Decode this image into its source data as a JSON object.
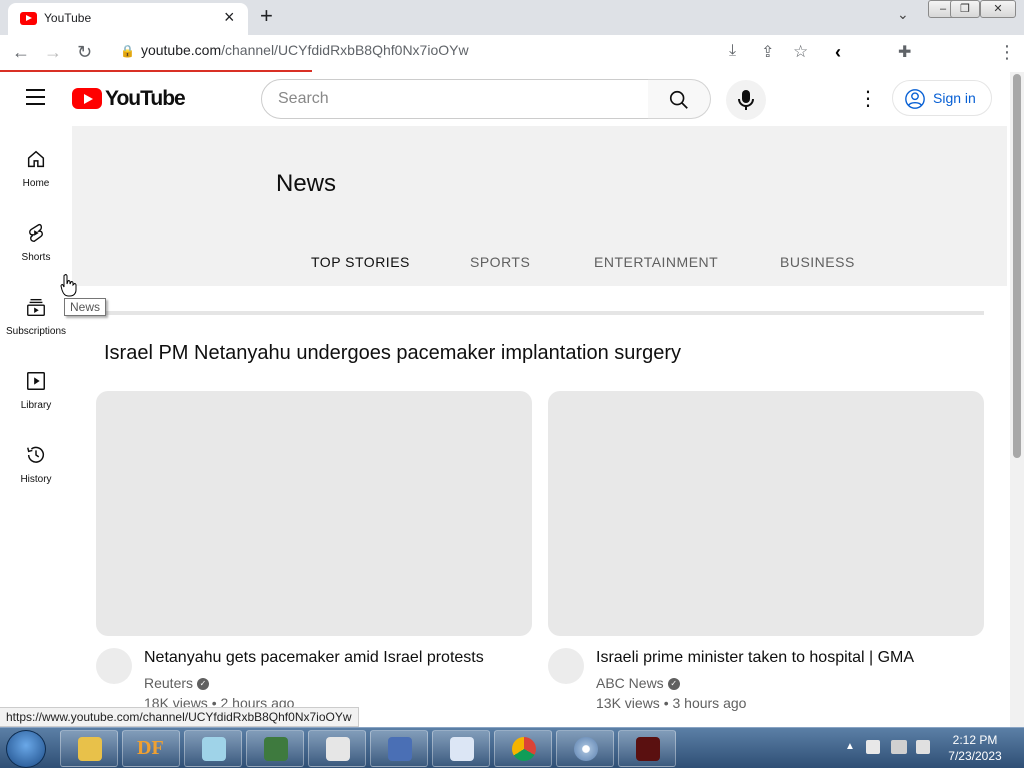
{
  "browser": {
    "tab_title": "YouTube",
    "url_host": "youtube.com",
    "url_path": "/channel/UCYfdidRxbB8Qhf0Nx7ioOYw",
    "status_url": "https://www.youtube.com/channel/UCYfdidRxbB8Qhf0Nx7ioOYw"
  },
  "header": {
    "logo_text": "YouTube",
    "search_placeholder": "Search",
    "signin_label": "Sign in"
  },
  "sidebar": {
    "items": [
      {
        "label": "Home",
        "icon": "home-icon"
      },
      {
        "label": "Shorts",
        "icon": "shorts-icon"
      },
      {
        "label": "Subscriptions",
        "icon": "subscriptions-icon"
      },
      {
        "label": "Library",
        "icon": "library-icon"
      },
      {
        "label": "History",
        "icon": "history-icon"
      }
    ]
  },
  "tooltip": "News",
  "channel": {
    "name": "News",
    "tabs": [
      "TOP STORIES",
      "SPORTS",
      "ENTERTAINMENT",
      "BUSINESS"
    ],
    "active_tab": "TOP STORIES"
  },
  "section": {
    "title": "Israel PM Netanyahu undergoes pacemaker implantation surgery",
    "videos": [
      {
        "title": "Netanyahu gets pacemaker amid Israel protests",
        "channel": "Reuters",
        "meta": "18K views • 2 hours ago"
      },
      {
        "title": "Israeli prime minister taken to hospital | GMA",
        "channel": "ABC News",
        "meta": "13K views • 3 hours ago"
      }
    ]
  },
  "taskbar": {
    "time": "2:12 PM",
    "date": "7/23/2023",
    "df_label": "DF"
  },
  "colors": {
    "brand_red": "#ff0000",
    "link_blue": "#065fd4",
    "loading_bar": "#d93025"
  }
}
